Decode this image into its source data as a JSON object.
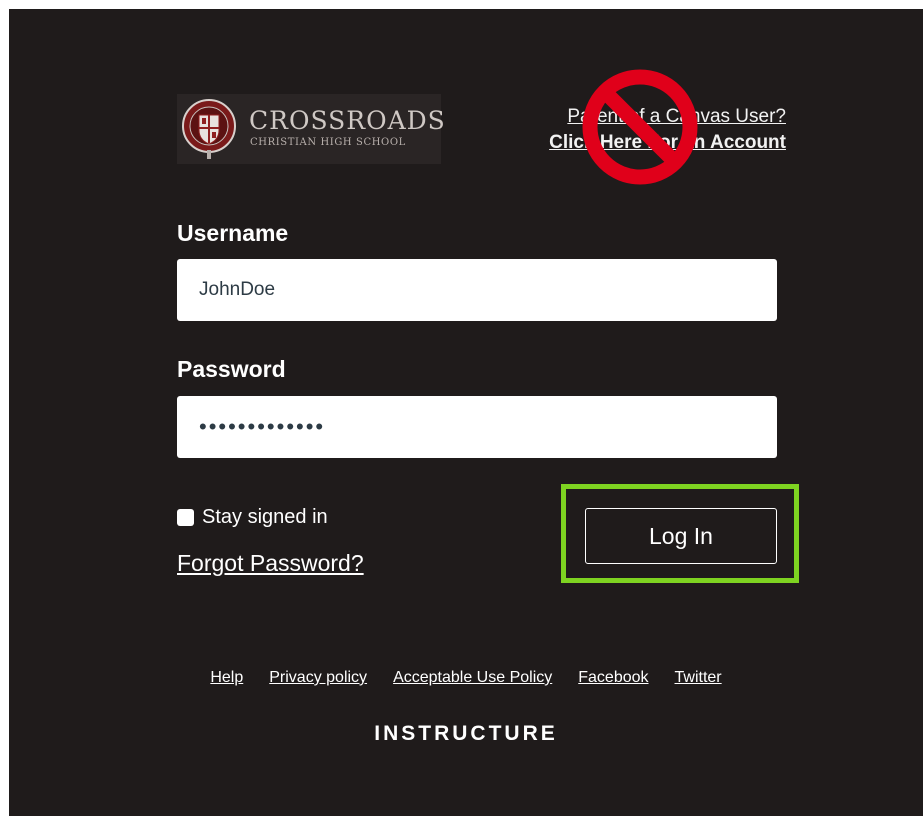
{
  "logo": {
    "name": "CROSSROADS",
    "subtitle": "CHRISTIAN HIGH SCHOOL",
    "seal_colors": {
      "outer": "#8f1f1f",
      "inner": "#c0c0c0"
    }
  },
  "parent_link": {
    "line1": "Parent of a Canvas User?",
    "line2": "Click Here For an Account"
  },
  "overlay": {
    "icon": "prohibited-sign-icon",
    "color": "#e0001a"
  },
  "form": {
    "username_label": "Username",
    "username_value": "JohnDoe",
    "password_label": "Password",
    "password_value": "•••••••••••••",
    "stay_signed_in_label": "Stay signed in",
    "forgot_password": "Forgot Password?",
    "login_button": "Log In",
    "highlight_color": "#7ed321"
  },
  "footer": {
    "links": [
      "Help",
      "Privacy policy",
      "Acceptable Use Policy",
      "Facebook",
      "Twitter"
    ],
    "brand": "INSTRUCTURE"
  }
}
